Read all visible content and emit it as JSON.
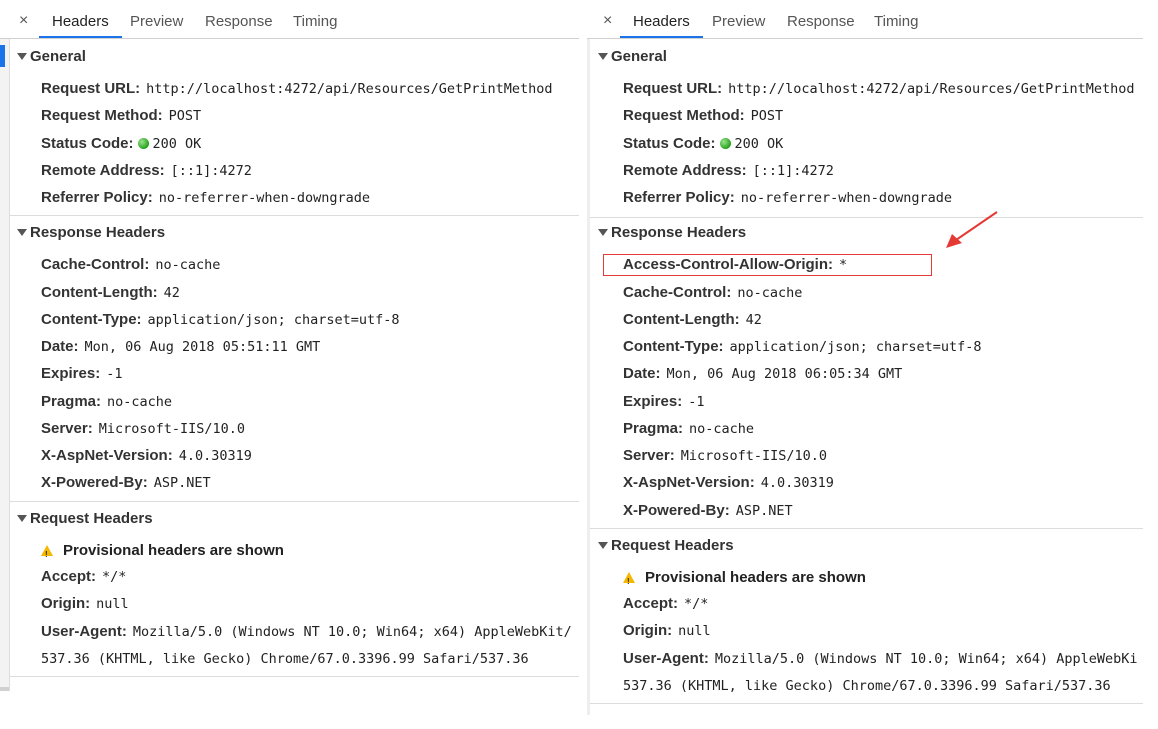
{
  "tabs": [
    "Headers",
    "Preview",
    "Response",
    "Timing"
  ],
  "close_glyph": "×",
  "sections": {
    "general": "General",
    "response_headers": "Response Headers",
    "request_headers": "Request Headers"
  },
  "general": [
    {
      "key": "Request URL:",
      "value": "http://localhost:4272/api/Resources/GetPrintMethod"
    },
    {
      "key": "Request Method:",
      "value": "POST"
    },
    {
      "key": "Status Code:",
      "value": "200 OK",
      "status_color": "#2ea31f"
    },
    {
      "key": "Remote Address:",
      "value": "[::1]:4272"
    },
    {
      "key": "Referrer Policy:",
      "value": "no-referrer-when-downgrade"
    }
  ],
  "left_response_headers": [
    {
      "key": "Cache-Control:",
      "value": "no-cache"
    },
    {
      "key": "Content-Length:",
      "value": "42"
    },
    {
      "key": "Content-Type:",
      "value": "application/json; charset=utf-8"
    },
    {
      "key": "Date:",
      "value": "Mon, 06 Aug 2018 05:51:11 GMT"
    },
    {
      "key": "Expires:",
      "value": "-1"
    },
    {
      "key": "Pragma:",
      "value": "no-cache"
    },
    {
      "key": "Server:",
      "value": "Microsoft-IIS/10.0"
    },
    {
      "key": "X-AspNet-Version:",
      "value": "4.0.30319"
    },
    {
      "key": "X-Powered-By:",
      "value": "ASP.NET"
    }
  ],
  "right_response_headers": [
    {
      "key": "Access-Control-Allow-Origin:",
      "value": "*"
    },
    {
      "key": "Cache-Control:",
      "value": "no-cache"
    },
    {
      "key": "Content-Length:",
      "value": "42"
    },
    {
      "key": "Content-Type:",
      "value": "application/json; charset=utf-8"
    },
    {
      "key": "Date:",
      "value": "Mon, 06 Aug 2018 06:05:34 GMT"
    },
    {
      "key": "Expires:",
      "value": "-1"
    },
    {
      "key": "Pragma:",
      "value": "no-cache"
    },
    {
      "key": "Server:",
      "value": "Microsoft-IIS/10.0"
    },
    {
      "key": "X-AspNet-Version:",
      "value": "4.0.30319"
    },
    {
      "key": "X-Powered-By:",
      "value": "ASP.NET"
    }
  ],
  "request_headers": {
    "provisional": "Provisional headers are shown",
    "items": [
      {
        "key": "Accept:",
        "value": "*/*"
      },
      {
        "key": "Origin:",
        "value": "null"
      }
    ],
    "user_agent_key": "User-Agent:",
    "left_ua_line1": "Mozilla/5.0 (Windows NT 10.0; Win64; x64) AppleWebKit/",
    "right_ua_line1": "Mozilla/5.0 (Windows NT 10.0; Win64; x64) AppleWebKi",
    "ua_line2": "537.36 (KHTML, like Gecko) Chrome/67.0.3396.99 Safari/537.36"
  },
  "colors": {
    "accent": "#1a73e8",
    "annotation": "#e53935",
    "warning": "#f5b800"
  }
}
